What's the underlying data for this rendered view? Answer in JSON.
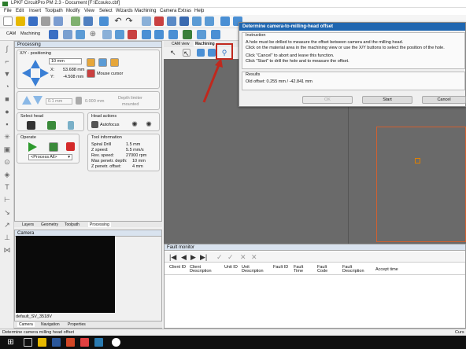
{
  "app": {
    "title": "LPKF CircuitPro PM 2.3 - Document [F:\\Ecouko.cbf]"
  },
  "menu": [
    "File",
    "Edit",
    "Insert",
    "Toolpath",
    "Modify",
    "View",
    "Select",
    "Wizards",
    "Machining",
    "Camera",
    "Extras",
    "Help"
  ],
  "toolbar2": {
    "mode1": "CAM",
    "mode2": "Machining"
  },
  "processing": {
    "panel_title": "Processing",
    "xy_label": "X/Y - positioning",
    "step": "10 mm",
    "x_label": "X:",
    "x_val": "53.688 mm",
    "y_label": "Y:",
    "y_val": "-4.508 mm",
    "mouse_cursor": "Mouse cursor",
    "depth_val": "0.1 mm",
    "depth_val2": "0.000 mm",
    "depth_limiter": "Depth limiter",
    "mounted": "mounted",
    "select_head": "Select head",
    "head_actions": "Head actions",
    "autofocus": "Autofocus",
    "operate": "Operate",
    "process_all": "<Process All>",
    "tool_info": "Tool information",
    "tool_rows": [
      {
        "k": "Spiral Drill",
        "v": "1.5 mm"
      },
      {
        "k": "Z speed:",
        "v": "5.5 mm/s"
      },
      {
        "k": "Rev. speed:",
        "v": "27000 rpm"
      },
      {
        "k": "Max penetr. depth:",
        "v": "10 mm"
      },
      {
        "k": "Z penetr. offset:",
        "v": "4 mm"
      }
    ]
  },
  "panel_tabs": [
    "Layers",
    "Geometry",
    "Toolpath",
    "Processing"
  ],
  "camera": {
    "title": "Camera",
    "device": "default_SV_3518V",
    "tabs": [
      "Camera",
      "Navigation",
      "Properties"
    ]
  },
  "work_tabs": [
    "CAM view",
    "Machining"
  ],
  "dialog": {
    "title": "Determine camera-to-milling-head offset",
    "instruction_hdr": "Instruction",
    "line1": "A hole must be drilled to measure the offset between camera and the milling head.",
    "line2": "Click on the material area in the machining view or use the X/Y buttons to select the position of the hole.",
    "line3": "Click \"Cancel\" to abort and leave this function.",
    "line4": "Click \"Start\" to drill the hole and to measure the offset.",
    "results_hdr": "Results",
    "old_offset": "Old offset: 0.255 mm / -42.841 mm",
    "ok": "OK",
    "start": "Start",
    "cancel": "Cancel"
  },
  "fault": {
    "title": "Fault monitor",
    "columns": [
      "Client ID",
      "Client Description",
      "Unit ID",
      "Unit Description",
      "Fault ID",
      "Fault Time",
      "Fault Code",
      "Fault Description",
      "Accept time"
    ]
  },
  "status": {
    "left": "Determine camera milling head offset",
    "right": "Curs"
  },
  "colors": {
    "accent": "#1f66b0",
    "highlight": "#c0281d",
    "board": "#d06030"
  }
}
